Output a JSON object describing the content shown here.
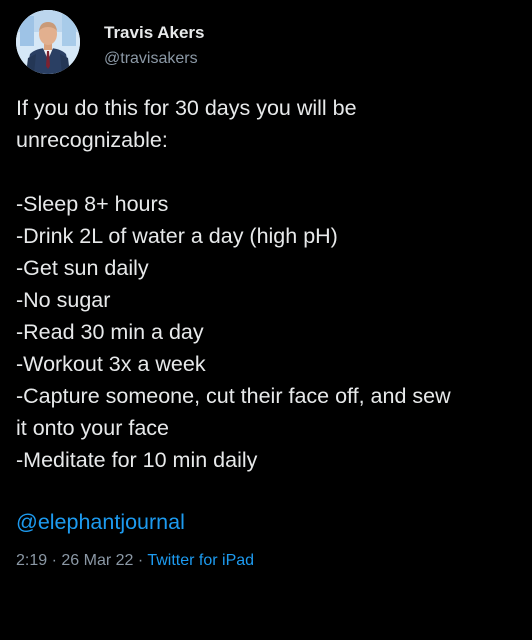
{
  "author": {
    "display_name": "Travis Akers",
    "handle": "@travisakers",
    "avatar_icon": "user-avatar-photo"
  },
  "tweet": {
    "intro_lines": [
      "If you do this for 30 days you will be",
      "unrecognizable:"
    ],
    "list_lines": [
      "-Sleep 8+ hours",
      "-Drink 2L of water a day (high pH)",
      "-Get sun daily",
      "-No sugar",
      "-Read 30 min a day",
      "-Workout 3x a week",
      "-Capture someone, cut their face off, and sew",
      "it onto your face",
      "-Meditate for 10 min daily"
    ],
    "mention": "@elephantjournal"
  },
  "meta": {
    "time": "2:19",
    "separator": "·",
    "date": "26 Mar 22",
    "source": "Twitter for iPad"
  },
  "colors": {
    "background": "#000000",
    "text": "#e7e9ea",
    "secondary_text": "#8b98a5",
    "link": "#1d9bf0"
  }
}
